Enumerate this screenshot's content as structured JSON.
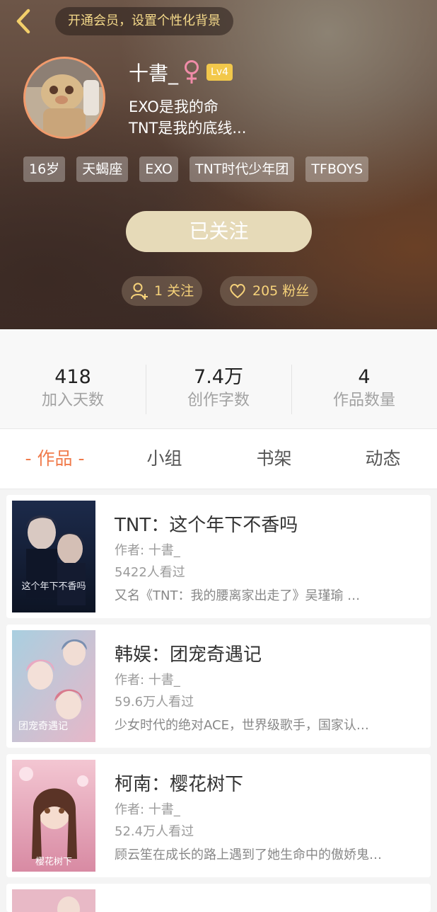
{
  "header": {
    "vip_prompt": "开通会员，设置个性化背景",
    "username": "十書_",
    "gender_symbol": "♀",
    "level": "Lv4",
    "bio_lines": [
      "EXO是我的命",
      "TNT是我的底线..."
    ],
    "tags": [
      "16岁",
      "天蝎座",
      "EXO",
      "TNT时代少年团",
      "TFBOYS"
    ],
    "follow_button": "已关注",
    "following": "1 关注",
    "fans": "205 粉丝"
  },
  "stats": [
    {
      "value": "418",
      "label": "加入天数"
    },
    {
      "value": "7.4万",
      "label": "创作字数"
    },
    {
      "value": "4",
      "label": "作品数量"
    }
  ],
  "tabs": [
    "- 作品 -",
    "小组",
    "书架",
    "动态"
  ],
  "works": [
    {
      "title": "TNT：这个年下不香吗",
      "author": "作者: 十書_",
      "views": "5422人看过",
      "desc": "又名《TNT：我的腰离家出走了》吴瑾瑜 …",
      "cover_text": "这个年下不香吗"
    },
    {
      "title": "韩娱：团宠奇遇记",
      "author": "作者: 十書_",
      "views": "59.6万人看过",
      "desc": "少女时代的绝对ACE，世界级歌手，国家认…",
      "cover_text": "团宠奇遇记"
    },
    {
      "title": "柯南：樱花树下",
      "author": "作者: 十書_",
      "views": "52.4万人看过",
      "desc": "顾云笙在成长的路上遇到了她生命中的傲娇鬼…",
      "cover_text": "樱花树下"
    }
  ],
  "colors": {
    "accent": "#f07b4b",
    "follow_button": "#e6dab8",
    "gold": "#f6d27a",
    "avatar_ring": "#f29a6b"
  }
}
